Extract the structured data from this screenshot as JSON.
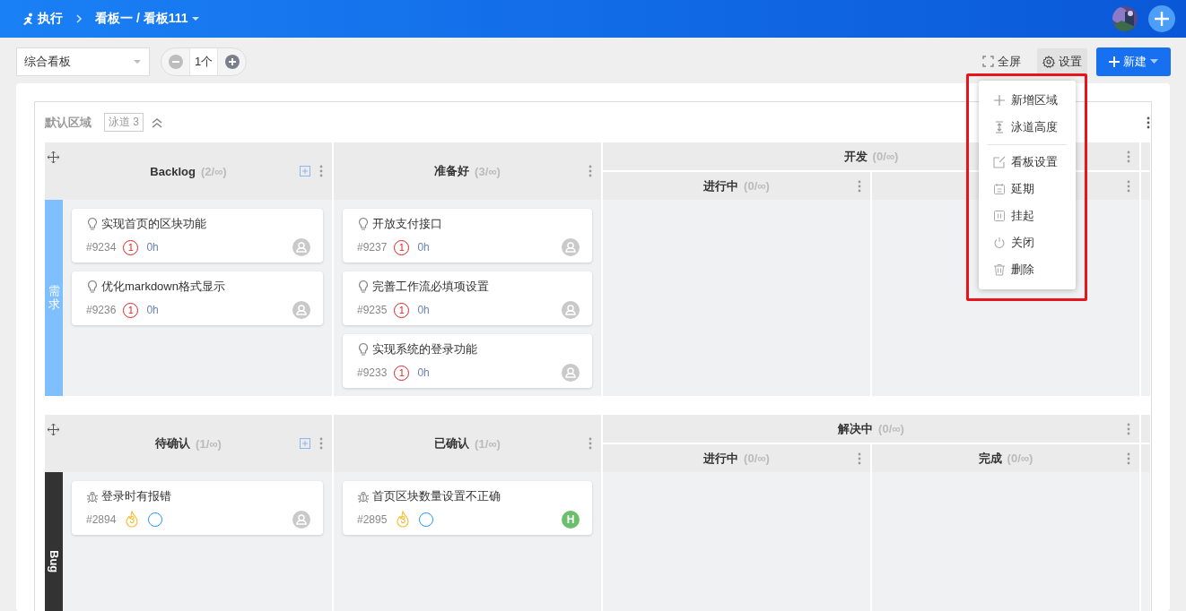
{
  "topbar": {
    "section": "执行",
    "breadcrumb": "看板一 / 看板111"
  },
  "toolbar": {
    "view_select": "综合看板",
    "stepper": {
      "value": "1个",
      "minus_disabled": true
    },
    "fullscreen": "全屏",
    "settings": {
      "label": "设置",
      "selected": true
    },
    "new_button": "新建"
  },
  "settings_menu": {
    "highlight": true,
    "groups": [
      [
        {
          "label": "新增区域"
        },
        {
          "label": "泳道高度"
        }
      ],
      [
        {
          "label": "看板设置"
        },
        {
          "label": "延期"
        },
        {
          "label": "挂起"
        },
        {
          "label": "关闭"
        },
        {
          "label": "删除"
        }
      ]
    ]
  },
  "region": {
    "title": "默认区域",
    "lane_tag": "泳道 3",
    "lanes": [
      {
        "label": "需求",
        "color": "#7fbfff",
        "kind": "stacked",
        "columns": [
          {
            "title": "Backlog",
            "count": "(2/∞)",
            "add_button": true,
            "cards": [
              {
                "kind": "story",
                "title": "实现首页的区块功能",
                "id": "#9234",
                "priority": "1",
                "hours": "0h"
              },
              {
                "kind": "story",
                "title": "优化markdown格式显示",
                "id": "#9236",
                "priority": "1",
                "hours": "0h"
              }
            ]
          },
          {
            "title": "准备好",
            "count": "(3/∞)",
            "add_button": false,
            "cards": [
              {
                "kind": "story",
                "title": "开放支付接口",
                "id": "#9237",
                "priority": "1",
                "hours": "0h"
              },
              {
                "kind": "story",
                "title": "完善工作流必填项设置",
                "id": "#9235",
                "priority": "1",
                "hours": "0h"
              },
              {
                "kind": "story",
                "title": "实现系统的登录功能",
                "id": "#9233",
                "priority": "1",
                "hours": "0h"
              }
            ]
          },
          {
            "title": "开发",
            "count": "(0/∞)",
            "children": [
              {
                "title": "进行中",
                "count": "(0/∞)"
              }
            ]
          }
        ]
      },
      {
        "label": "Bug",
        "color": "#333333",
        "kind": "rotated",
        "columns": [
          {
            "title": "待确认",
            "count": "(1/∞)",
            "add_button": true,
            "cards": [
              {
                "kind": "bug",
                "title": "登录时有报错",
                "id": "#2894",
                "severity": "3"
              }
            ]
          },
          {
            "title": "已确认",
            "count": "(1/∞)",
            "add_button": false,
            "cards": [
              {
                "kind": "bug",
                "title": "首页区块数量设置不正确",
                "id": "#2895",
                "severity": "3",
                "assignee": {
                  "initial": "H",
                  "color": "#6cbf6a"
                }
              }
            ]
          },
          {
            "title": "解决中",
            "count": "(0/∞)",
            "children": [
              {
                "title": "进行中",
                "count": "(0/∞)"
              },
              {
                "title": "完成",
                "count": "(0/∞)"
              }
            ]
          }
        ]
      }
    ]
  }
}
